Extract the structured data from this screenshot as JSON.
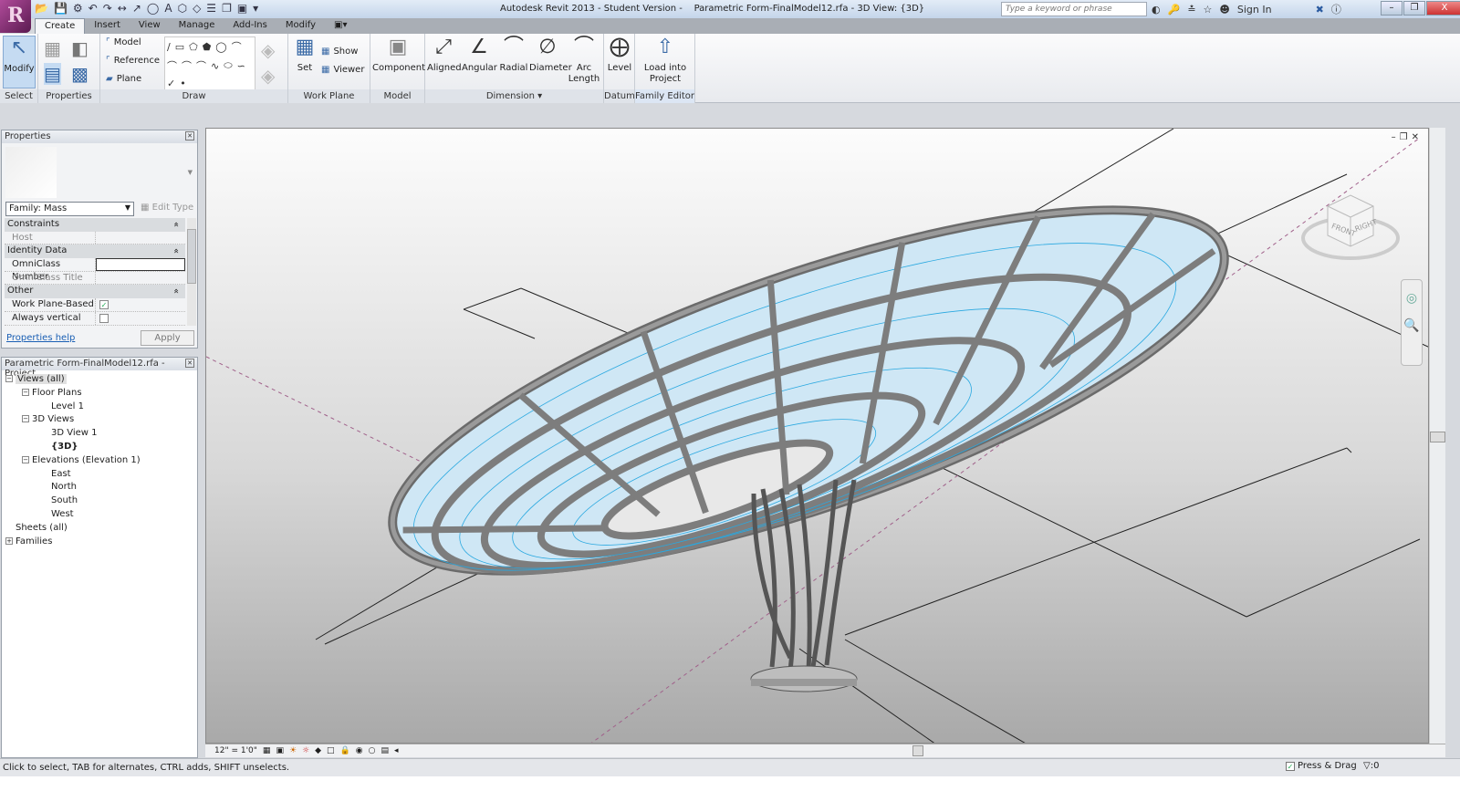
{
  "app": {
    "title": "Autodesk Revit 2013 - Student Version -    Parametric Form-FinalModel12.rfa - 3D View: {3D}",
    "search_placeholder": "Type a keyword or phrase",
    "sign_in": "Sign In",
    "logo_letter": "R"
  },
  "tabs": [
    "Create",
    "Insert",
    "View",
    "Manage",
    "Add-Ins",
    "Modify"
  ],
  "ribbon": {
    "select": {
      "label": "Select",
      "modify": "Modify"
    },
    "properties": {
      "label": "Properties"
    },
    "draw": {
      "label": "Draw",
      "model": "Model",
      "reference": "Reference",
      "plane": "Plane"
    },
    "work_plane": {
      "label": "Work Plane",
      "set": "Set",
      "show": "Show",
      "viewer": "Viewer"
    },
    "model": {
      "label": "Model",
      "component": "Component"
    },
    "dimension": {
      "label": "Dimension",
      "aligned": "Aligned",
      "angular": "Angular",
      "radial": "Radial",
      "diameter": "Diameter",
      "arc_length": "Arc Length"
    },
    "datum": {
      "label": "Datum",
      "level": "Level"
    },
    "family_editor": {
      "label": "Family Editor",
      "load": "Load into Project"
    }
  },
  "properties": {
    "title": "Properties",
    "family": "Family: Mass",
    "edit_type": "Edit Type",
    "groups": [
      {
        "name": "Constraints",
        "rows": [
          {
            "key": "Host",
            "value": "",
            "dim": true
          }
        ]
      },
      {
        "name": "Identity Data",
        "rows": [
          {
            "key": "OmniClass Number",
            "value": ""
          },
          {
            "key": "OmniClass Title",
            "value": "",
            "dim": true
          }
        ]
      },
      {
        "name": "Other",
        "rows": [
          {
            "key": "Work Plane-Based",
            "checked": true
          },
          {
            "key": "Always vertical",
            "checked": false
          }
        ]
      }
    ],
    "help": "Properties help",
    "apply": "Apply"
  },
  "browser": {
    "title": "Parametric Form-FinalModel12.rfa - Project ...",
    "items": [
      {
        "label": "Views (all)",
        "level": 0
      },
      {
        "label": "Floor Plans",
        "level": 1
      },
      {
        "label": "Level 1",
        "level": 2
      },
      {
        "label": "3D Views",
        "level": 1
      },
      {
        "label": "3D View 1",
        "level": 2
      },
      {
        "label": "{3D}",
        "level": 2,
        "bold": true
      },
      {
        "label": "Elevations (Elevation 1)",
        "level": 1
      },
      {
        "label": "East",
        "level": 2
      },
      {
        "label": "North",
        "level": 2
      },
      {
        "label": "South",
        "level": 2
      },
      {
        "label": "West",
        "level": 2
      },
      {
        "label": "Sheets (all)",
        "level": 0
      },
      {
        "label": "Families",
        "level": 0
      }
    ]
  },
  "viewcube": {
    "front": "FRONT",
    "right": "RIGHT"
  },
  "viewbar": {
    "scale": "12\" = 1'0\""
  },
  "status": {
    "message": "Click to select, TAB for alternates, CTRL adds, SHIFT unselects.",
    "press_drag": "Press & Drag",
    "filter_count": ":0"
  },
  "colors": {
    "accent": "#3a6aa6",
    "grid": "#29a8e0"
  }
}
